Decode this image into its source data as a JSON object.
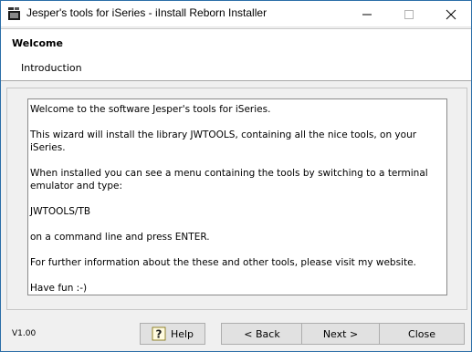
{
  "window": {
    "title": "Jesper's tools for iSeries - iInstall Reborn Installer"
  },
  "header": {
    "title": "Welcome",
    "subtitle": "Introduction"
  },
  "content": {
    "paragraphs": [
      "Welcome to the software Jesper's tools for iSeries.",
      "This wizard will install the library JWTOOLS, containing all the nice tools, on your iSeries.",
      "When installed you can see a menu containing the tools by switching to a terminal emulator and type:",
      "JWTOOLS/TB",
      "on a command line and press ENTER.",
      "For further information about the these and other tools, please visit my website.",
      "Have fun :-)"
    ]
  },
  "footer": {
    "version": "V1.00",
    "help_label": "Help",
    "back_label": "< Back",
    "next_label": "Next >",
    "close_label": "Close"
  },
  "colors": {
    "window_border": "#2b6ea8",
    "background": "#f0f0f0",
    "button_face": "#e1e1e1"
  },
  "icons": {
    "app": "java-cup-icon",
    "minimize": "minimize-icon",
    "maximize": "maximize-icon",
    "close": "close-icon",
    "help": "question-mark-icon"
  }
}
